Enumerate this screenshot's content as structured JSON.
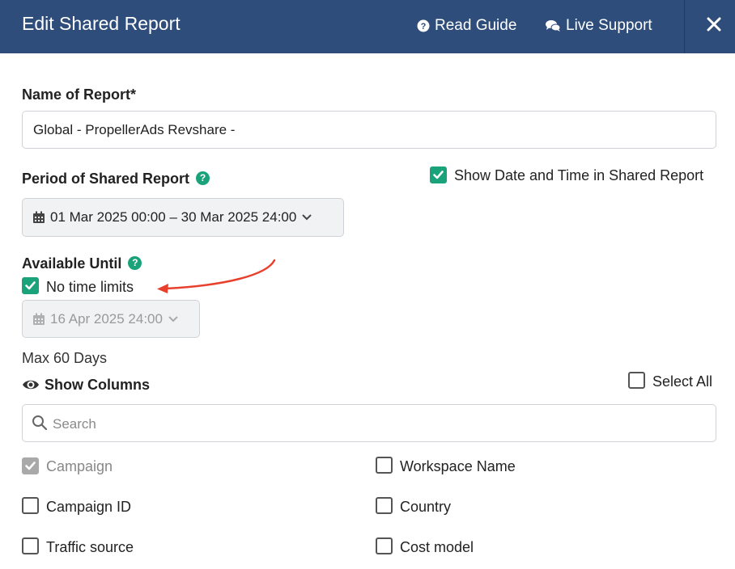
{
  "header": {
    "title": "Edit Shared Report",
    "read_guide": "Read Guide",
    "live_support": "Live Support"
  },
  "form": {
    "name_label": "Name of Report*",
    "name_value": "Global - PropellerAds Revshare -",
    "period_label": "Period of Shared Report",
    "period_value": "01 Mar 2025 00:00 – 30 Mar 2025 24:00",
    "show_datetime_label": "Show Date and Time in Shared Report",
    "show_datetime_checked": true,
    "available_label": "Available Until",
    "no_limits_label": "No time limits",
    "no_limits_checked": true,
    "available_date": "16 Apr 2025 24:00",
    "max_days": "Max 60 Days",
    "show_columns": "Show Columns",
    "select_all": "Select All",
    "search_placeholder": "Search"
  },
  "columns": [
    {
      "label": "Campaign",
      "checked": true,
      "disabled": true
    },
    {
      "label": "Workspace Name",
      "checked": false,
      "disabled": false
    },
    {
      "label": "Campaign ID",
      "checked": false,
      "disabled": false
    },
    {
      "label": "Country",
      "checked": false,
      "disabled": false
    },
    {
      "label": "Traffic source",
      "checked": false,
      "disabled": false
    },
    {
      "label": "Cost model",
      "checked": false,
      "disabled": false
    }
  ],
  "colors": {
    "header": "#2e4d7b",
    "accent": "#1aa37a",
    "arrow": "#e8402c"
  },
  "icons": [
    "help-circle-icon",
    "chat-bubbles-icon",
    "close-icon",
    "calendar-icon",
    "chevron-down-icon",
    "eye-icon",
    "search-icon",
    "check-icon",
    "arrow-annotation"
  ]
}
